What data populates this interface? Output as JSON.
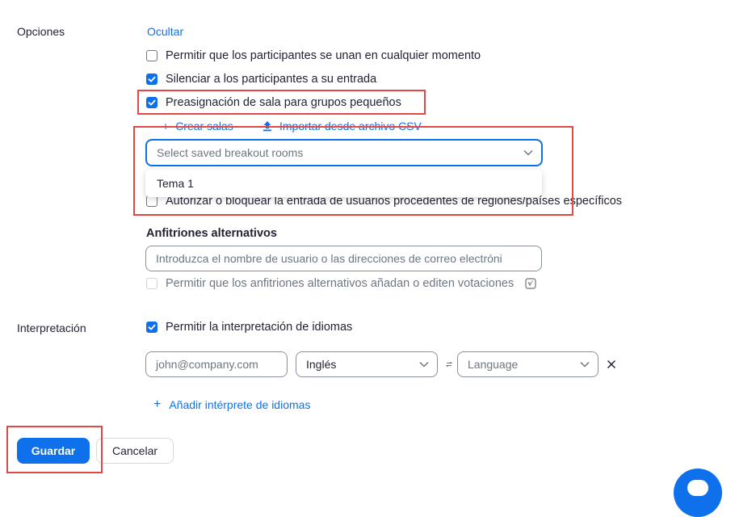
{
  "options": {
    "label": "Opciones",
    "hide_link": "Ocultar",
    "allow_join_anytime": "Permitir que los participantes se unan en cualquier momento",
    "mute_on_entry": "Silenciar a los participantes a su entrada",
    "breakout_preassign": "Preasignación de sala para grupos pequeños",
    "create_rooms": "Crear salas",
    "import_csv": "Importar desde archivo CSV",
    "saved_rooms_placeholder": "Select saved breakout rooms",
    "dropdown_options": [
      "Tema 1"
    ],
    "region_block": "Autorizar o bloquear la entrada de usuarios procedentes de regiones/países específicos"
  },
  "alt_hosts": {
    "title": "Anfitriones alternativos",
    "placeholder": "Introduzca el nombre de usuario o las direcciones de correo electróni",
    "allow_polls": "Permitir que los anfitriones alternativos añadan o editen votaciones"
  },
  "interpretation": {
    "label": "Interpretación",
    "allow": "Permitir la interpretación de idiomas",
    "email_placeholder": "john@company.com",
    "language_from": "Inglés",
    "language_to_placeholder": "Language",
    "add_interpreter": "Añadir intérprete de idiomas"
  },
  "actions": {
    "save": "Guardar",
    "cancel": "Cancelar"
  },
  "colors": {
    "accent": "#0e71eb",
    "highlight": "#e04848"
  }
}
